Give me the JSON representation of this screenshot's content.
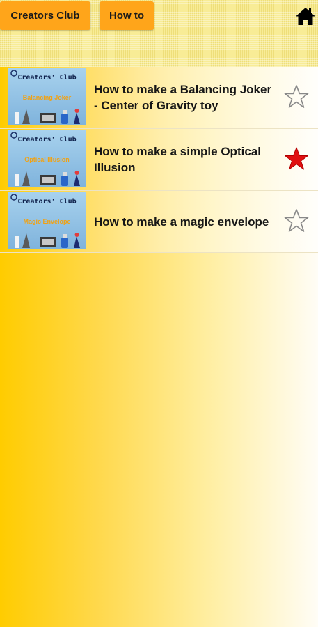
{
  "toolbar": {
    "creators_club_label": "Creators Club",
    "how_to_label": "How to",
    "home_icon": "home-icon"
  },
  "thumbnail": {
    "brand": "Creators' Club"
  },
  "items": [
    {
      "thumb_label": "Balancing Joker",
      "title": "How to make a Balancing Joker - Center of Gravity toy",
      "favorite": false
    },
    {
      "thumb_label": "Optical Illusion",
      "title": "How to make a simple Optical Illusion",
      "favorite": true
    },
    {
      "thumb_label": "Magic Envelope",
      "title": "How to make a magic envelope",
      "favorite": false
    }
  ],
  "colors": {
    "button": "#ffa51a",
    "star_on": "#e01010",
    "star_off": "#888888",
    "thumb_bg": "#8fc1e6"
  }
}
